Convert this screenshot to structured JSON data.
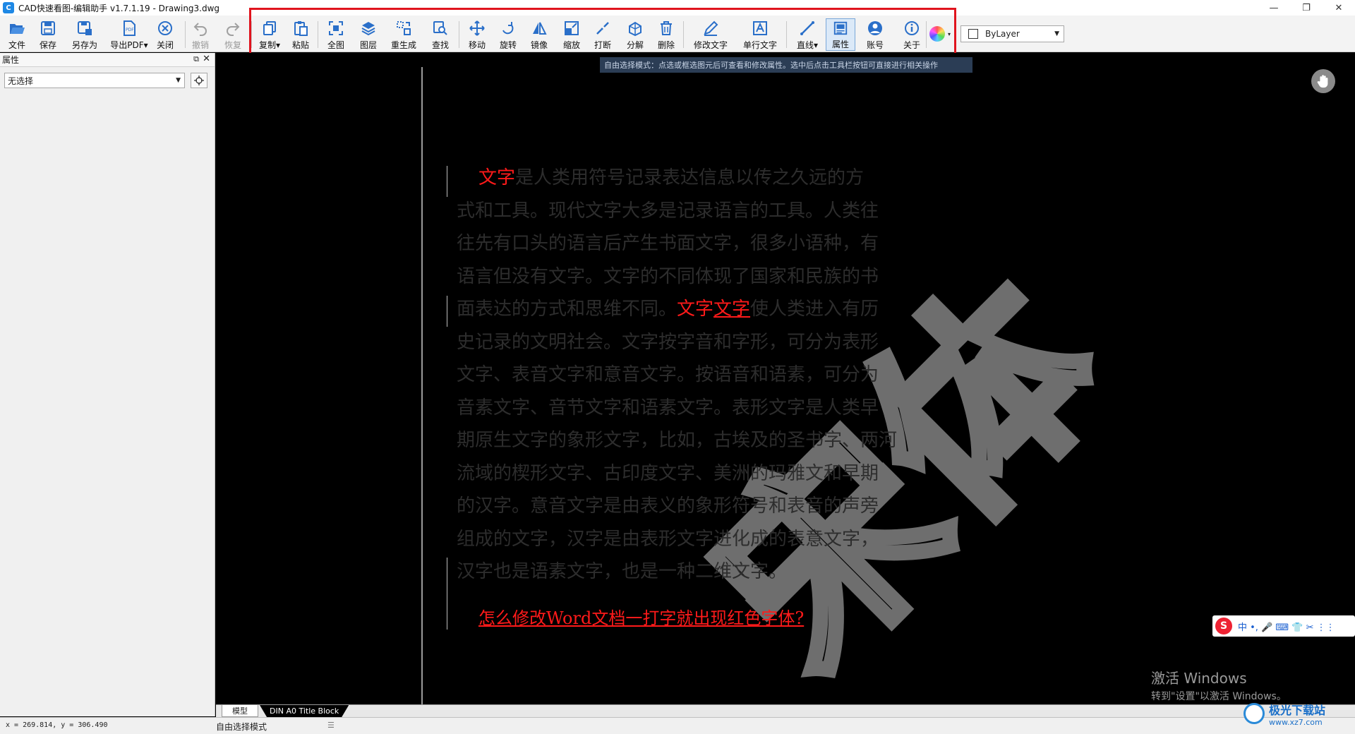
{
  "window": {
    "title": "CAD快速看图-编辑助手 v1.7.1.19 - Drawing3.dwg",
    "buttons": [
      "—",
      "❐",
      "✕"
    ]
  },
  "toolbar": {
    "file": "文件",
    "save": "保存",
    "save_as": "另存为",
    "export_pdf": "导出PDF",
    "close": "关闭",
    "undo": "撤销",
    "redo": "恢复",
    "copy": "复制",
    "paste": "粘贴",
    "fit_all": "全图",
    "layers": "图层",
    "regen": "重生成",
    "find": "查找",
    "move": "移动",
    "rotate": "旋转",
    "mirror": "镜像",
    "scale": "缩放",
    "break": "打断",
    "explode": "分解",
    "delete": "删除",
    "edit_text": "修改文字",
    "single_text": "单行文字",
    "line": "直线",
    "properties": "属性",
    "account": "账号",
    "about": "关于",
    "bylayer": "ByLayer"
  },
  "panel": {
    "title": "属性",
    "selection": "无选择"
  },
  "canvas": {
    "tooltip": "自由选择模式：点选或框选图元后可查看和修改属性。选中后点击工具栏按钮可直接进行相关操作",
    "paragraph": {
      "l1_red": "文字",
      "l1_rest": "是人类用符号记录表达信息以传之久远的方",
      "l2": "式和工具。现代文字大多是记录语言的工具。人类往",
      "l3": "往先有口头的语言后产生书面文字，很多小语种，有",
      "l4": "语言但没有文字。文字的不同体现了国家和民族的书",
      "l5_a": "面表达的方式和思维不同。",
      "l5_red": "文字",
      "l5_red_u": "文字",
      "l5_b": "使人类进入有历",
      "l6": "史记录的文明社会。文字按字音和字形，可分为表形",
      "l7": "文字、表音文字和意音文字。按语音和语素，可分为",
      "l8": "音素文字、音节文字和语素文字。表形文字是人类早",
      "l9": "期原生文字的象形文字，比如，古埃及的圣书字、两河",
      "l10": "流域的楔形文字、古印度文字、美洲的玛雅文和早期",
      "l11": "的汉字。意音文字是由表义的象形符号和表音的声旁",
      "l12": "组成的文字，汉字是由表形文字进化成的表意文字，",
      "l13": "汉字也是语素文字，也是一种二维文字。"
    },
    "question": "怎么修改Word文档一打字就出现红色字体?",
    "big_text": "宋体",
    "activate_title": "激活 Windows",
    "activate_sub": "转到\"设置\"以激活 Windows。",
    "ime": "中 •, 🎤 ⌨ 👕 ✂ ⋮⋮"
  },
  "tabs": {
    "model": "模型",
    "layout": "DIN A0 Title Block"
  },
  "status": {
    "coords": "x = 269.814,  y = 306.490",
    "mode": "自由选择模式"
  },
  "watermark": {
    "name": "极光下载站",
    "url": "www.xz7.com"
  },
  "colors": {
    "accent_red": "#ff1a1a",
    "highlight_box": "#e0141e",
    "toolbar_bg": "#f3f3f3",
    "icon_blue": "#2a6fc9"
  }
}
